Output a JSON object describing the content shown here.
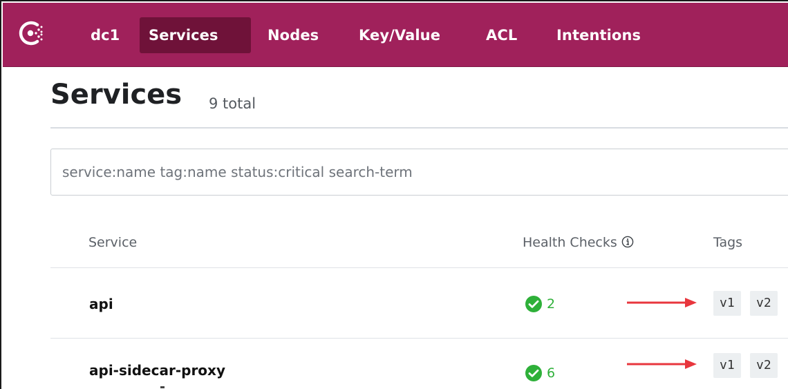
{
  "nav": {
    "logo": "consul-logo-icon",
    "datacenter": "dc1",
    "items": [
      {
        "label": "Services",
        "active": true
      },
      {
        "label": "Nodes",
        "active": false
      },
      {
        "label": "Key/Value",
        "active": false
      },
      {
        "label": "ACL",
        "active": false
      },
      {
        "label": "Intentions",
        "active": false
      }
    ]
  },
  "page": {
    "title": "Services",
    "count": "9 total"
  },
  "search": {
    "placeholder": "service:name tag:name status:critical search-term",
    "value": ""
  },
  "table": {
    "headers": {
      "service": "Service",
      "health_checks": "Health Checks",
      "tags": "Tags"
    },
    "rows": [
      {
        "name": "api",
        "checks": "2",
        "status": "passing",
        "tags": [
          "v1",
          "v2"
        ]
      },
      {
        "name": "api-sidecar-proxy",
        "checks": "6",
        "status": "passing",
        "tags": [
          "v1",
          "v2"
        ]
      }
    ]
  },
  "colors": {
    "nav_bg": "#a0215b",
    "nav_active": "#6f1239",
    "passing": "#2eb039",
    "annotation_arrow": "#e8363d"
  }
}
